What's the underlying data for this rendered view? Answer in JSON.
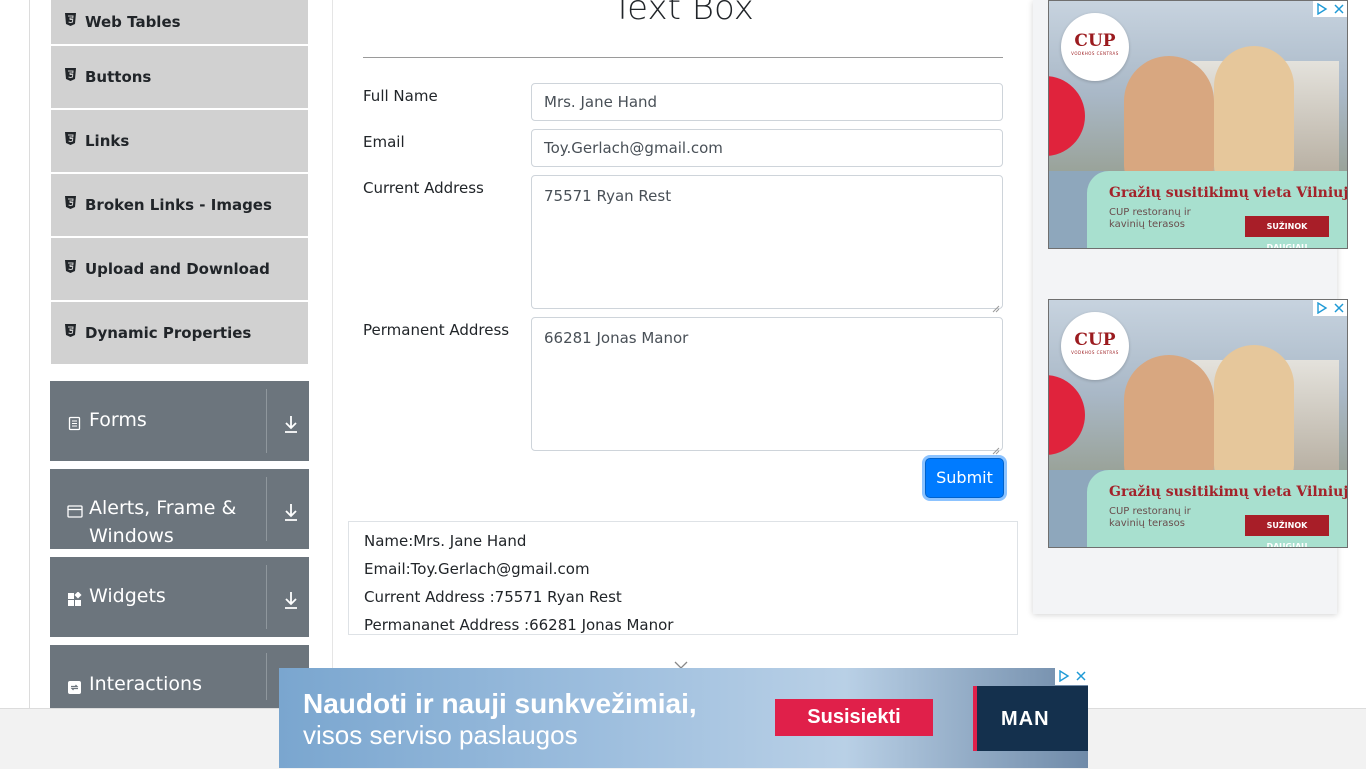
{
  "sidebar": {
    "elements_items": [
      {
        "label": "Web Tables"
      },
      {
        "label": "Buttons"
      },
      {
        "label": "Links"
      },
      {
        "label": "Broken Links - Images"
      },
      {
        "label": "Upload and Download"
      },
      {
        "label": "Dynamic Properties"
      }
    ],
    "groups": [
      {
        "label": "Forms",
        "icon": "form-icon"
      },
      {
        "label": "Alerts, Frame & Windows",
        "icon": "window-icon"
      },
      {
        "label": "Widgets",
        "icon": "widgets-icon"
      },
      {
        "label": "Interactions",
        "icon": "interactions-icon"
      }
    ]
  },
  "main": {
    "title": "Text Box",
    "form": {
      "full_name": {
        "label": "Full Name",
        "value": "Mrs. Jane Hand"
      },
      "email": {
        "label": "Email",
        "value": "Toy.Gerlach@gmail.com"
      },
      "current_address": {
        "label": "Current Address",
        "value": "75571 Ryan Rest"
      },
      "permanent_address": {
        "label": "Permanent Address",
        "value": "66281 Jonas Manor"
      },
      "submit_label": "Submit"
    },
    "output": {
      "name": "Name:Mrs. Jane Hand",
      "email": "Email:Toy.Gerlach@gmail.com",
      "current_address": "Current Address :75571 Ryan Rest",
      "permanent_address": "Permananet Address :66281 Jonas Manor"
    }
  },
  "ads": {
    "side_ad": {
      "logo": "CUP",
      "logo_sub": "VODKHOS CENTRAS",
      "headline": "Gražių susitikimų vieta Vilniuje",
      "subtext": "CUP restoranų ir kavinių terasos",
      "cta": "SUŽINOK DAUGIAU"
    },
    "bottom_banner": {
      "line1": "Naudoti ir nauji sunkvežimiai,",
      "line2": "visos serviso paslaugos",
      "cta": "Susisiekti",
      "brand": "MAN"
    }
  },
  "colors": {
    "primary": "#007bff",
    "sidebar_group": "#6c757d",
    "sidebar_item": "#d1d1d1"
  }
}
